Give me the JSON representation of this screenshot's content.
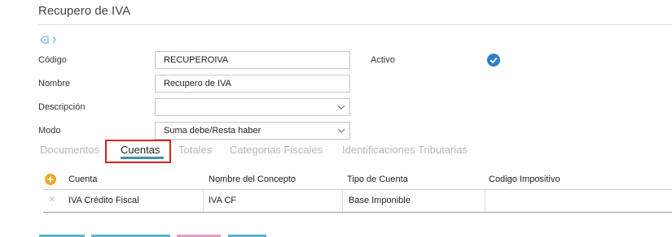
{
  "page": {
    "title": "Recupero de IVA"
  },
  "form": {
    "codigo": {
      "label": "Código",
      "value": "RECUPEROIVA"
    },
    "nombre": {
      "label": "Nombre",
      "value": "Recupero de IVA"
    },
    "descripcion": {
      "label": "Descripción",
      "value": ""
    },
    "modo": {
      "label": "Modo",
      "value": "Suma debe/Resta haber"
    },
    "activo": {
      "label": "Activo",
      "checked": true
    }
  },
  "tabs": [
    {
      "label": "Documentos",
      "active": false
    },
    {
      "label": "Cuentas",
      "active": true
    },
    {
      "label": "Totales",
      "active": false
    },
    {
      "label": "Categorias Fiscales",
      "active": false
    },
    {
      "label": "Identificaciones Tributarias",
      "active": false
    }
  ],
  "grid": {
    "columns": [
      "Cuenta",
      "Nombre del Concepto",
      "Tipo de Cuenta",
      "Codigo Impositivo"
    ],
    "rows": [
      {
        "cuenta": "IVA Crédito Fiscal",
        "concepto": "IVA CF",
        "tipo": "Base Imponible",
        "codigo": ""
      }
    ]
  },
  "colors": {
    "accent": "#3a93ac",
    "check": "#2a7fc9",
    "add": "#f5a623",
    "annotation": "#e02020"
  },
  "icons": [
    "tag-icon",
    "chevron-right-icon",
    "chevron-down-icon",
    "check-circle-icon",
    "add-circle-icon",
    "remove-icon"
  ]
}
